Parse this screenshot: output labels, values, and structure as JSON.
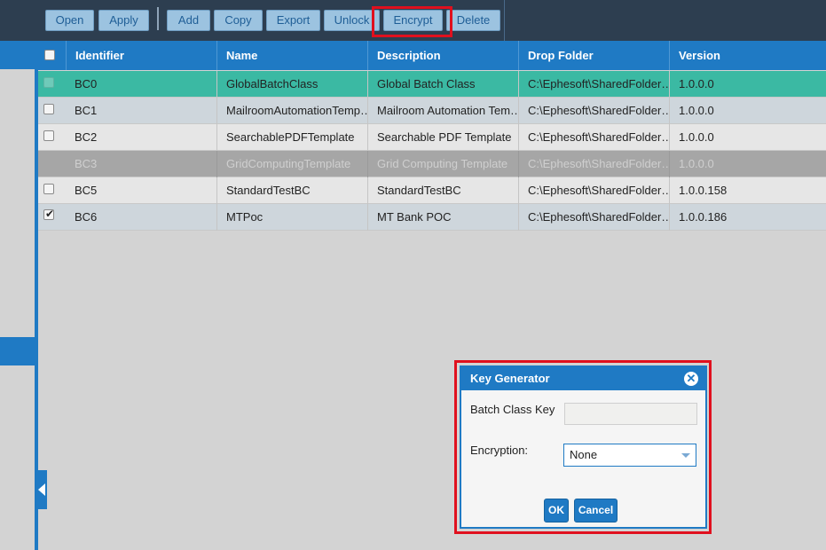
{
  "toolbar": {
    "buttons": [
      "Open",
      "Apply",
      "Add",
      "Copy",
      "Export",
      "Unlock",
      "Encrypt",
      "Delete"
    ]
  },
  "grid": {
    "columns": [
      "Identifier",
      "Name",
      "Description",
      "Drop Folder",
      "Version"
    ],
    "rows": [
      {
        "id": "BC0",
        "name": "GlobalBatchClass",
        "description": "Global Batch Class",
        "folder": "C:\\Ephesoft\\SharedFolder…",
        "version": "1.0.0.0"
      },
      {
        "id": "BC1",
        "name": "MailroomAutomationTemp…",
        "description": "Mailroom Automation Tem…",
        "folder": "C:\\Ephesoft\\SharedFolder…",
        "version": "1.0.0.0"
      },
      {
        "id": "BC2",
        "name": "SearchablePDFTemplate",
        "description": "Searchable PDF Template",
        "folder": "C:\\Ephesoft\\SharedFolder…",
        "version": "1.0.0.0"
      },
      {
        "id": "BC3",
        "name": "GridComputingTemplate",
        "description": "Grid Computing Template",
        "folder": "C:\\Ephesoft\\SharedFolder…",
        "version": "1.0.0.0"
      },
      {
        "id": "BC5",
        "name": "StandardTestBC",
        "description": "StandardTestBC",
        "folder": "C:\\Ephesoft\\SharedFolder…",
        "version": "1.0.0.158"
      },
      {
        "id": "BC6",
        "name": "MTPoc",
        "description": "MT Bank POC",
        "folder": "C:\\Ephesoft\\SharedFolder…",
        "version": "1.0.0.186"
      }
    ]
  },
  "dialog": {
    "title": "Key Generator",
    "key_label": "Batch Class Key",
    "key_value": "",
    "encryption_label": "Encryption:",
    "encryption_value": "None",
    "ok_label": "OK",
    "cancel_label": "Cancel"
  },
  "colors": {
    "toolbar_bg": "#2d3e50",
    "header_bg": "#1f7ac4",
    "selected_row": "#3bb9a3",
    "disabled_row": "#a6a6a6",
    "highlight": "#e0101e"
  }
}
